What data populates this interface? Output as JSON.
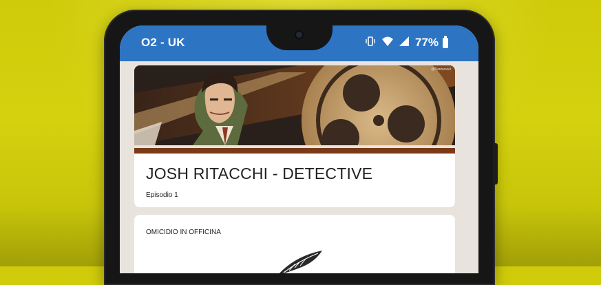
{
  "status_bar": {
    "carrier": "O2 - UK",
    "battery_percent": "77%",
    "icons": [
      "vibrate-icon",
      "wifi-icon",
      "signal-icon",
      "battery-icon"
    ],
    "background_color": "#2d74c3"
  },
  "form": {
    "theme_color": "#7b3a17",
    "header_image": "detective-banner",
    "header_credit": "@Dantanviel",
    "title": "JOSH RITACCHI - DETECTIVE",
    "description": "Episodio 1",
    "questions": [
      {
        "title": "OMICIDIO IN OFFICINA",
        "image": "feather-sketch"
      }
    ]
  },
  "background": {
    "color": "#d4d10f"
  }
}
